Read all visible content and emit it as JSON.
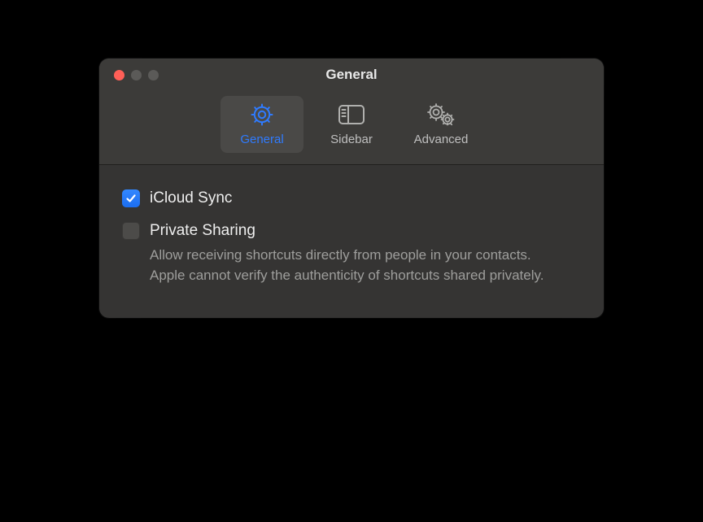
{
  "window": {
    "title": "General"
  },
  "toolbar": {
    "items": [
      {
        "label": "General",
        "icon": "gear-icon",
        "selected": true
      },
      {
        "label": "Sidebar",
        "icon": "sidebar-icon",
        "selected": false
      },
      {
        "label": "Advanced",
        "icon": "gears-icon",
        "selected": false
      }
    ]
  },
  "settings": {
    "icloud_sync": {
      "label": "iCloud Sync",
      "checked": true
    },
    "private_sharing": {
      "label": "Private Sharing",
      "checked": false,
      "description": "Allow receiving shortcuts directly from people in your contacts. Apple cannot verify the authenticity of shortcuts shared privately."
    }
  },
  "colors": {
    "accent": "#2f7bff",
    "windowBg": "#353433",
    "titlebarBg": "#3c3b39"
  }
}
